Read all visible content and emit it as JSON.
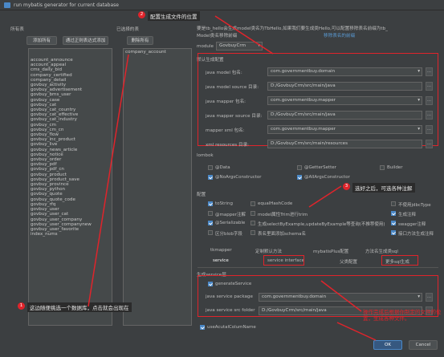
{
  "window": {
    "title": "run mybatis generator for current database"
  },
  "left": {
    "all_tables_label": "所有表",
    "selected_label": "已选择的表",
    "add_all": "添加所有",
    "add_regex": "通过正则表达式添加",
    "remove_all": "删除所有",
    "tables": [
      "account_announce",
      "account_appeal",
      "cms_daily_bid",
      "company_certified",
      "company_detail",
      "govbuy_activity",
      "govbuy_advertisement",
      "govbuy_bms_user",
      "govbuy_case",
      "govbuy_cat",
      "govbuy_cat_country",
      "govbuy_cat_effective",
      "govbuy_cat_industry",
      "govbuy_cm",
      "govbuy_cm_cn",
      "govbuy_flow",
      "govbuy_inc_product",
      "govbuy_live",
      "govbuy_news_article",
      "govbuy_notice",
      "govbuy_order",
      "govbuy_pdf",
      "govbuy_pdf_cn",
      "govbuy_product",
      "govbuy_product_save",
      "govbuy_province",
      "govbuy_python",
      "govbuy_quote",
      "govbuy_quote_code",
      "govbuy_rfq",
      "govbuy_user",
      "govbuy_user_cat",
      "govbuy_user_company",
      "govbuy_user_companynew",
      "govbuy_user_favorite",
      "index_nums"
    ],
    "selected_tables": [
      "company_account"
    ]
  },
  "right": {
    "top_note": "要是tb_hello会生成model类名为TbHello,如果我们要生成类Hello,可以配置移除表名前缀为tb_",
    "model_prefix_label": "Model类名移除前缀",
    "prefix_link": "移除表名的前缀",
    "module_label": "module",
    "module_value": "GovbuyCrm",
    "model_section_label": "默认生成配置",
    "fields": [
      {
        "label": "java model 包名:",
        "value": "com.governmentbuy.domain",
        "type": "select"
      },
      {
        "label": "java model source 目录:",
        "value": "D:/GovbuyCrm/src/main/java",
        "type": "path"
      },
      {
        "label": "java mapper 包名:",
        "value": "com.governmentbuy.mapper",
        "type": "select"
      },
      {
        "label": "java mapper source 目录:",
        "value": "D:/GovbuyCrm/src/main/java",
        "type": "path"
      },
      {
        "label": "mapper xml 包名:",
        "value": "com.governmentbuy.mapper",
        "type": "select"
      },
      {
        "label": "xml resources 目录:",
        "value": "D:/GovbuyCrm/src/main/resources",
        "type": "path"
      }
    ],
    "lombok_label": "lombok",
    "lombok": [
      {
        "label": "@Data",
        "on": false
      },
      {
        "label": "@GetterSetter",
        "on": false
      },
      {
        "label": "Builder",
        "on": false
      },
      {
        "label": "@NoArgsConstructor",
        "on": true
      },
      {
        "label": "@AllArgsConstructor",
        "on": true
      }
    ],
    "config_label": "配置",
    "config": [
      {
        "label": "toString",
        "on": true
      },
      {
        "label": "equalHashCode",
        "on": false
      },
      {
        "label": "不使用jdbcType",
        "on": false
      },
      {
        "label": "@mapper注解",
        "on": false
      },
      {
        "label": "model属性Trim进行trim",
        "on": false
      },
      {
        "label": "生成注释",
        "on": true
      },
      {
        "label": "@Serializable",
        "on": true
      },
      {
        "label": "生成selectByExample,updateByExample等查询(不推荐使用)",
        "on": false
      },
      {
        "label": "swagger注释",
        "on": true
      },
      {
        "label": "区分blob字段",
        "on": false
      },
      {
        "label": "表名里面添加schema名",
        "on": false
      },
      {
        "label": "接口方法生成注释",
        "on": true
      }
    ],
    "tabs_row1": [
      "tkmapper",
      "定制默认方法",
      "mybatisPlus配置",
      "方法名生成类sql"
    ],
    "tabs_row2": [
      "service",
      "service interface",
      "父类配置",
      "更多sql生成"
    ],
    "service_section_label": "生成service层",
    "generate_service_label": "generateService",
    "service_fields": [
      {
        "label": "java service package",
        "value": "com.governmentbuy.domain"
      },
      {
        "label": "java service src folder",
        "value": "D:/GovbuyCrm/src/main/java"
      }
    ],
    "use_actual_label": "useAcutalColumName",
    "ok": "OK",
    "cancel": "Cancel"
  },
  "annotations": {
    "a1": "这边随便挑选一个数据库，点击就会出现在",
    "a2": "配置生成文件的位置",
    "a3": "选好之后，可选各种注解",
    "a4": "操作完成后根据你制定的文件的位置，生成各种文件。",
    "n1": "1",
    "n2": "2",
    "n3": "3"
  },
  "colors": {
    "accent": "#4a88c7",
    "annotation": "#e0242b",
    "background": "#3c3f41"
  }
}
